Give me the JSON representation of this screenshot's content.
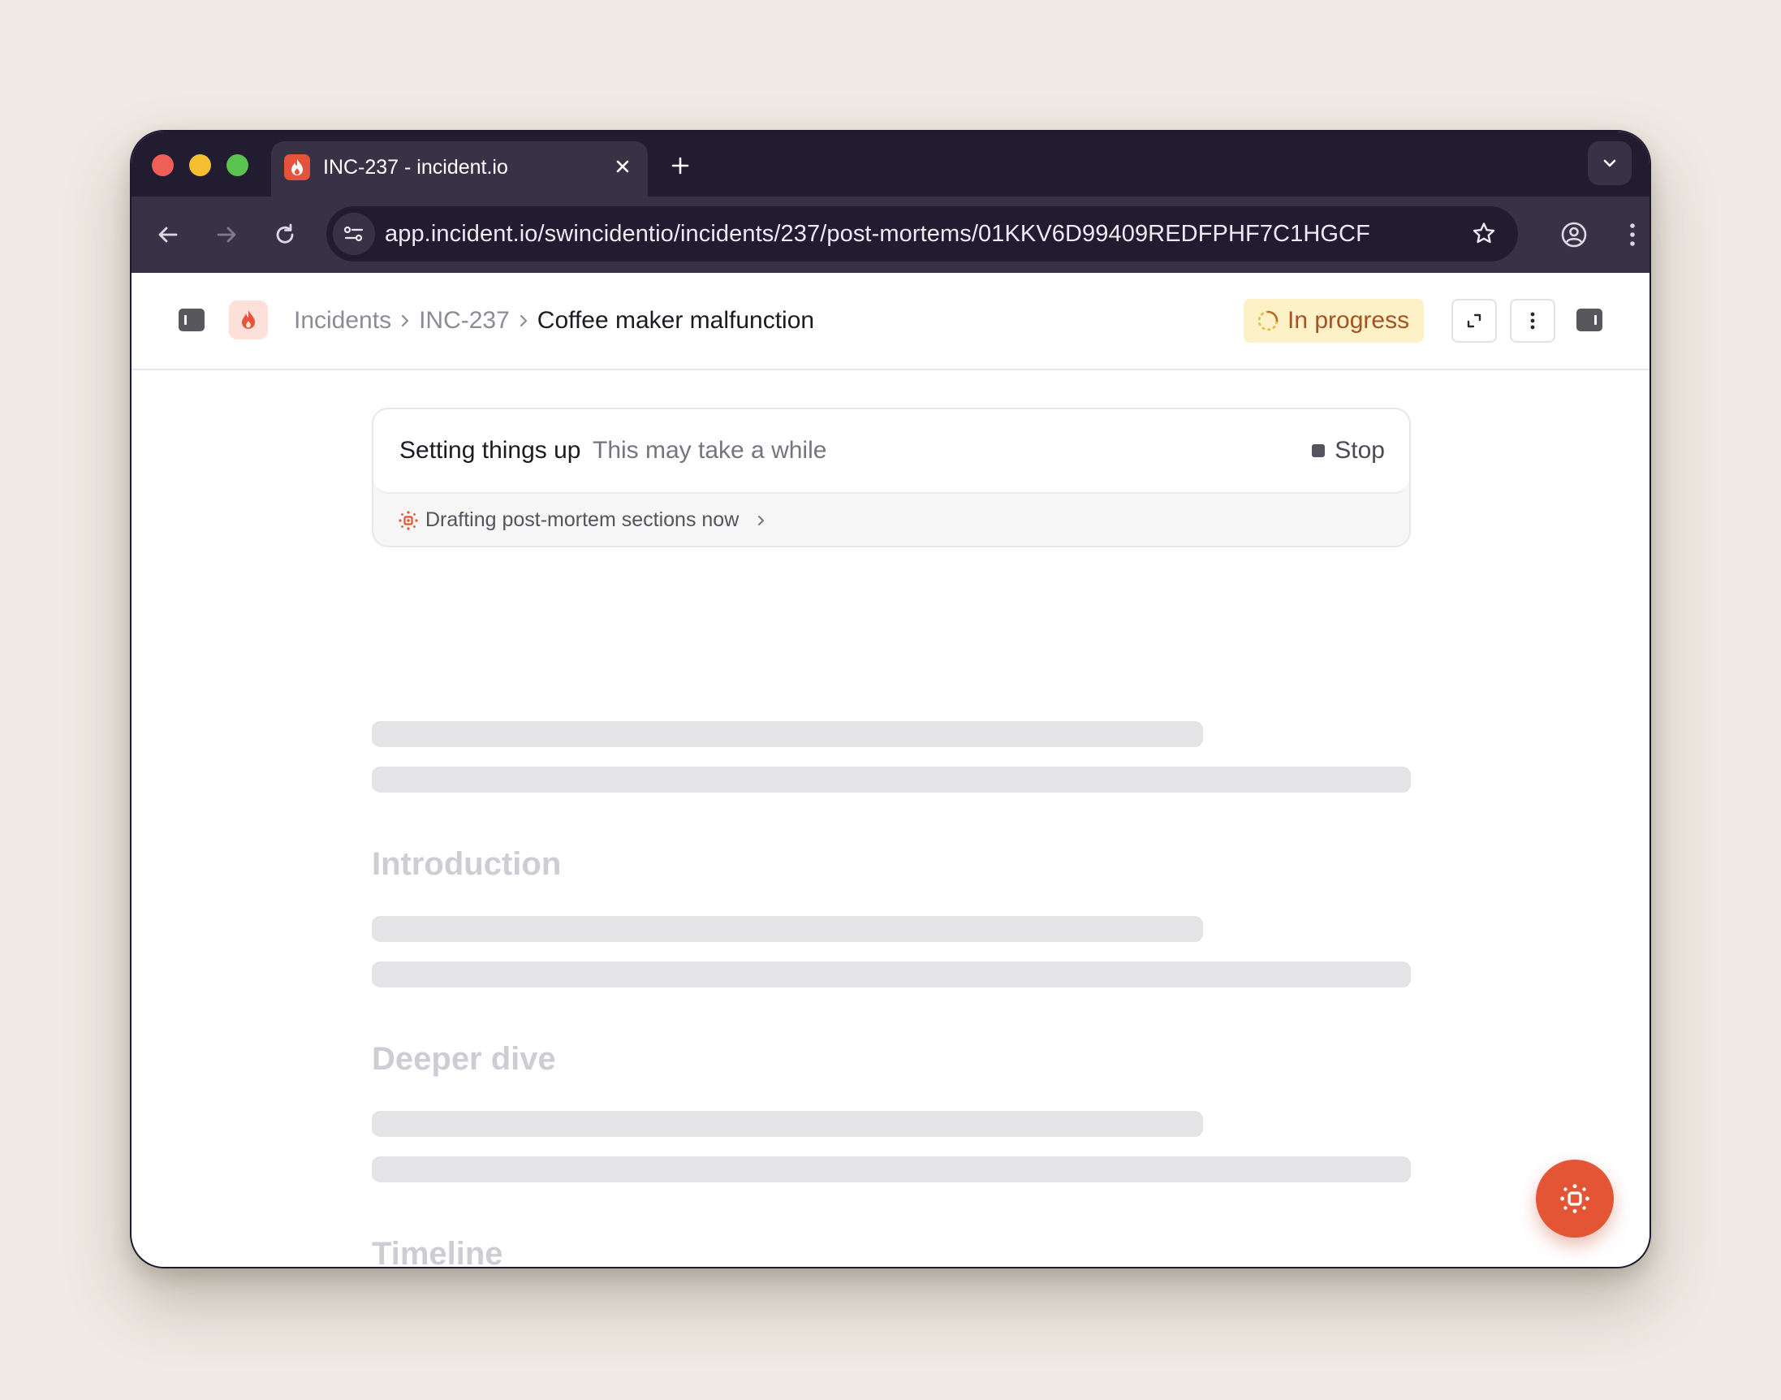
{
  "browser": {
    "tab_title": "INC-237 - incident.io",
    "url": "app.incident.io/swincidentio/incidents/237/post-mortems/01KKV6D99409REDFPHF7C1HGCF"
  },
  "header": {
    "breadcrumbs": [
      "Incidents",
      "INC-237",
      "Coffee maker malfunction"
    ],
    "status": "In progress"
  },
  "setup": {
    "title": "Setting things up",
    "subtitle": "This may take a while",
    "stop_label": "Stop",
    "drafting_label": "Drafting post-mortem sections now"
  },
  "sections": [
    "Introduction",
    "Deeper dive",
    "Timeline"
  ],
  "colors": {
    "accent": "#e35534",
    "status_bg": "#fdf1c8",
    "status_text": "#a55322",
    "chrome_dark": "#221c31"
  }
}
